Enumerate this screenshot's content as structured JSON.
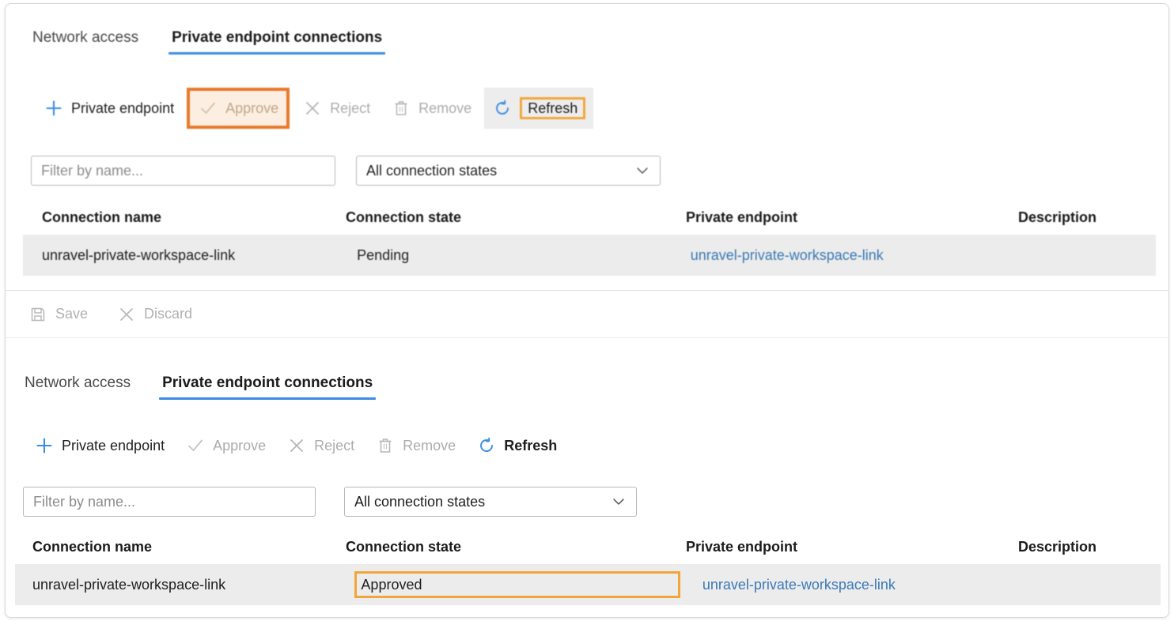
{
  "colors": {
    "accent_blue": "#3b8ce2",
    "link_blue": "#3b79b5",
    "highlight_orange": "#e8792b",
    "highlight_amber": "#f2a63a",
    "highlight_fill": "#fcefe1",
    "row_background": "#ececec",
    "disabled_text": "#acacac"
  },
  "top_panel": {
    "tabs": [
      {
        "label": "Network access",
        "active": false
      },
      {
        "label": "Private endpoint connections",
        "active": true
      }
    ],
    "toolbar": [
      {
        "label": "Private endpoint",
        "icon": "plus-icon",
        "state": "enabled"
      },
      {
        "label": "Approve",
        "icon": "checkmark-icon",
        "state": "disabled",
        "highlight": "orange-box"
      },
      {
        "label": "Reject",
        "icon": "cross-icon",
        "state": "disabled"
      },
      {
        "label": "Remove",
        "icon": "trash-icon",
        "state": "disabled"
      },
      {
        "label": "Refresh",
        "icon": "refresh-icon",
        "state": "enabled",
        "highlight": "amber-label-box"
      }
    ],
    "filter": {
      "name_placeholder": "Filter by name...",
      "name_value": "",
      "state_selected": "All connection states",
      "state_chevron": "chevron-down-icon"
    },
    "table": {
      "columns": [
        "Connection name",
        "Connection state",
        "Private endpoint",
        "Description"
      ],
      "rows": [
        {
          "connection_name": "unravel-private-workspace-link",
          "connection_state": "Pending",
          "private_endpoint": "unravel-private-workspace-link",
          "description": ""
        }
      ]
    }
  },
  "bottom_panel": {
    "savebar": [
      {
        "label": "Save",
        "icon": "save-icon",
        "state": "disabled"
      },
      {
        "label": "Discard",
        "icon": "cross-icon",
        "state": "disabled"
      }
    ],
    "tabs": [
      {
        "label": "Network access",
        "active": false
      },
      {
        "label": "Private endpoint connections",
        "active": true
      }
    ],
    "toolbar": [
      {
        "label": "Private endpoint",
        "icon": "plus-icon",
        "state": "enabled"
      },
      {
        "label": "Approve",
        "icon": "checkmark-icon",
        "state": "disabled"
      },
      {
        "label": "Reject",
        "icon": "cross-icon",
        "state": "disabled"
      },
      {
        "label": "Remove",
        "icon": "trash-icon",
        "state": "disabled"
      },
      {
        "label": "Refresh",
        "icon": "refresh-icon",
        "state": "enabled"
      }
    ],
    "filter": {
      "name_placeholder": "Filter by name...",
      "name_value": "",
      "state_selected": "All connection states",
      "state_chevron": "chevron-down-icon"
    },
    "table": {
      "columns": [
        "Connection name",
        "Connection state",
        "Private endpoint",
        "Description"
      ],
      "rows": [
        {
          "connection_name": "unravel-private-workspace-link",
          "connection_state": "Approved",
          "private_endpoint": "unravel-private-workspace-link",
          "description": ""
        }
      ]
    }
  }
}
